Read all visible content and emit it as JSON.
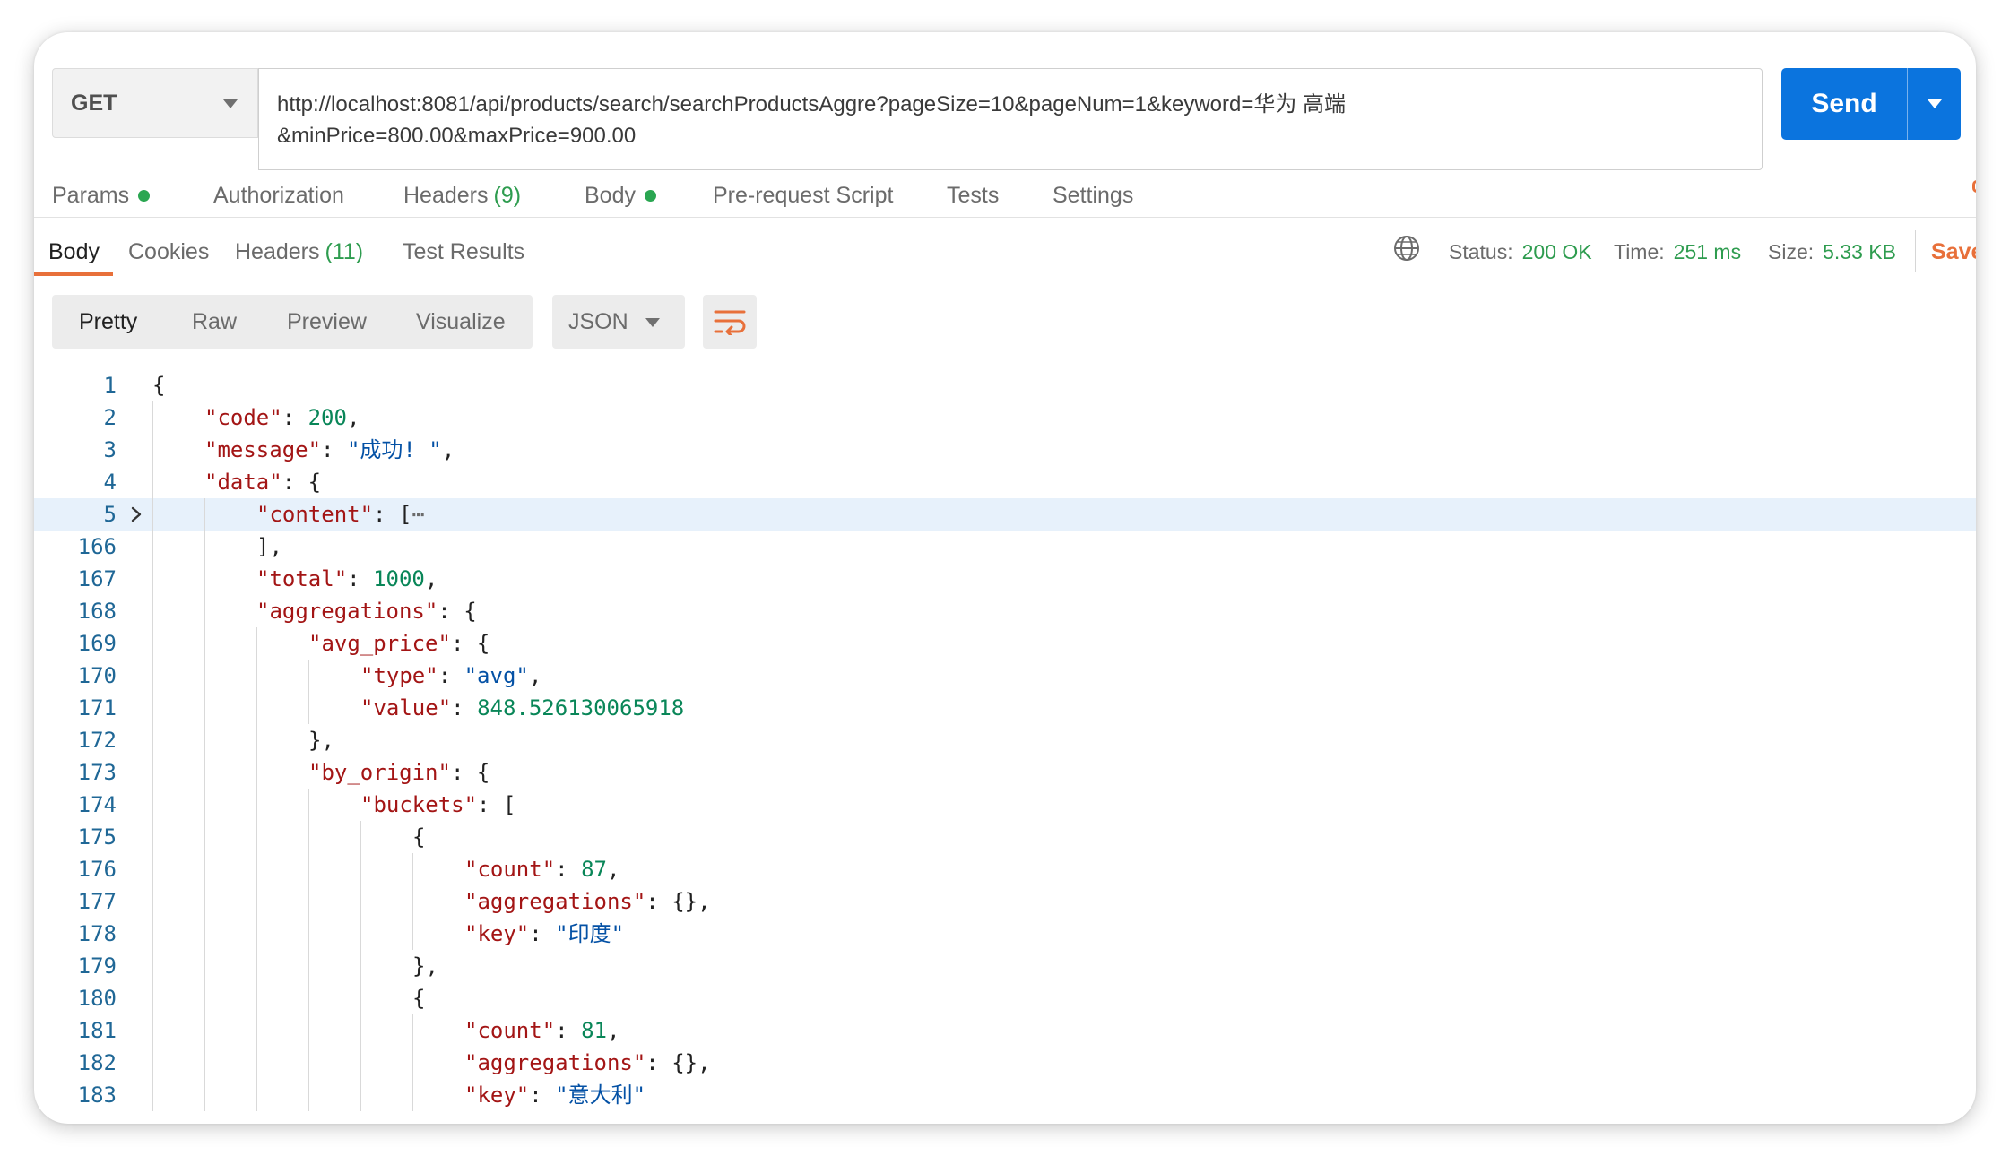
{
  "request": {
    "method": "GET",
    "url_line1": "http://localhost:8081/api/products/search/searchProductsAggre?pageSize=10&pageNum=1&keyword=华为 高端",
    "url_line2": "&minPrice=800.00&maxPrice=900.00",
    "send_label": "Send"
  },
  "request_tabs": [
    {
      "label": "Params",
      "count": "",
      "dot": true
    },
    {
      "label": "Authorization",
      "count": "",
      "dot": false
    },
    {
      "label": "Headers",
      "count": "(9)",
      "dot": false
    },
    {
      "label": "Body",
      "count": "",
      "dot": true
    },
    {
      "label": "Pre-request Script",
      "count": "",
      "dot": false
    },
    {
      "label": "Tests",
      "count": "",
      "dot": false
    },
    {
      "label": "Settings",
      "count": "",
      "dot": false
    }
  ],
  "response_tabs": [
    {
      "label": "Body",
      "count": ""
    },
    {
      "label": "Cookies",
      "count": ""
    },
    {
      "label": "Headers",
      "count": "(11)"
    },
    {
      "label": "Test Results",
      "count": ""
    }
  ],
  "response_status": {
    "status_label": "Status:",
    "status_value": "200 OK",
    "time_label": "Time:",
    "time_value": "251 ms",
    "size_label": "Size:",
    "size_value": "5.33 KB",
    "save_label": "Save"
  },
  "view_modes": [
    "Pretty",
    "Raw",
    "Preview",
    "Visualize"
  ],
  "format": "JSON",
  "icons": {
    "globe": "globe-icon",
    "wrap": "word-wrap-icon",
    "fold": "chevron-right-icon"
  },
  "colors": {
    "accent": "#e8703a",
    "send": "#0b74de",
    "success": "#2e9c4f",
    "key": "#a31515",
    "string": "#0451a5",
    "number": "#098658"
  },
  "code_lines": [
    {
      "n": "1",
      "indent": 0,
      "parts": [
        [
          "p",
          "{"
        ]
      ]
    },
    {
      "n": "2",
      "indent": 1,
      "parts": [
        [
          "k",
          "\"code\""
        ],
        [
          "p",
          ": "
        ],
        [
          "n",
          "200"
        ],
        [
          "p",
          ","
        ]
      ]
    },
    {
      "n": "3",
      "indent": 1,
      "parts": [
        [
          "k",
          "\"message\""
        ],
        [
          "p",
          ": "
        ],
        [
          "s",
          "\"成功! \""
        ],
        [
          "p",
          ","
        ]
      ]
    },
    {
      "n": "4",
      "indent": 1,
      "parts": [
        [
          "k",
          "\"data\""
        ],
        [
          "p",
          ": {"
        ]
      ]
    },
    {
      "n": "5",
      "indent": 2,
      "fold": true,
      "hl": true,
      "parts": [
        [
          "k",
          "\"content\""
        ],
        [
          "p",
          ": ["
        ],
        [
          "e",
          "⋯"
        ]
      ]
    },
    {
      "n": "166",
      "indent": 2,
      "parts": [
        [
          "p",
          "],"
        ]
      ]
    },
    {
      "n": "167",
      "indent": 2,
      "parts": [
        [
          "k",
          "\"total\""
        ],
        [
          "p",
          ": "
        ],
        [
          "n",
          "1000"
        ],
        [
          "p",
          ","
        ]
      ]
    },
    {
      "n": "168",
      "indent": 2,
      "parts": [
        [
          "k",
          "\"aggregations\""
        ],
        [
          "p",
          ": {"
        ]
      ]
    },
    {
      "n": "169",
      "indent": 3,
      "parts": [
        [
          "k",
          "\"avg_price\""
        ],
        [
          "p",
          ": {"
        ]
      ]
    },
    {
      "n": "170",
      "indent": 4,
      "parts": [
        [
          "k",
          "\"type\""
        ],
        [
          "p",
          ": "
        ],
        [
          "s",
          "\"avg\""
        ],
        [
          "p",
          ","
        ]
      ]
    },
    {
      "n": "171",
      "indent": 4,
      "parts": [
        [
          "k",
          "\"value\""
        ],
        [
          "p",
          ": "
        ],
        [
          "n",
          "848.526130065918"
        ]
      ]
    },
    {
      "n": "172",
      "indent": 3,
      "parts": [
        [
          "p",
          "},"
        ]
      ]
    },
    {
      "n": "173",
      "indent": 3,
      "parts": [
        [
          "k",
          "\"by_origin\""
        ],
        [
          "p",
          ": {"
        ]
      ]
    },
    {
      "n": "174",
      "indent": 4,
      "parts": [
        [
          "k",
          "\"buckets\""
        ],
        [
          "p",
          ": ["
        ]
      ]
    },
    {
      "n": "175",
      "indent": 5,
      "parts": [
        [
          "p",
          "{"
        ]
      ]
    },
    {
      "n": "176",
      "indent": 6,
      "parts": [
        [
          "k",
          "\"count\""
        ],
        [
          "p",
          ": "
        ],
        [
          "n",
          "87"
        ],
        [
          "p",
          ","
        ]
      ]
    },
    {
      "n": "177",
      "indent": 6,
      "parts": [
        [
          "k",
          "\"aggregations\""
        ],
        [
          "p",
          ": {},"
        ]
      ]
    },
    {
      "n": "178",
      "indent": 6,
      "parts": [
        [
          "k",
          "\"key\""
        ],
        [
          "p",
          ": "
        ],
        [
          "s",
          "\"印度\""
        ]
      ]
    },
    {
      "n": "179",
      "indent": 5,
      "parts": [
        [
          "p",
          "},"
        ]
      ]
    },
    {
      "n": "180",
      "indent": 5,
      "parts": [
        [
          "p",
          "{"
        ]
      ]
    },
    {
      "n": "181",
      "indent": 6,
      "parts": [
        [
          "k",
          "\"count\""
        ],
        [
          "p",
          ": "
        ],
        [
          "n",
          "81"
        ],
        [
          "p",
          ","
        ]
      ]
    },
    {
      "n": "182",
      "indent": 6,
      "parts": [
        [
          "k",
          "\"aggregations\""
        ],
        [
          "p",
          ": {},"
        ]
      ]
    },
    {
      "n": "183",
      "indent": 6,
      "parts": [
        [
          "k",
          "\"key\""
        ],
        [
          "p",
          ": "
        ],
        [
          "s",
          "\"意大利\""
        ]
      ]
    }
  ]
}
